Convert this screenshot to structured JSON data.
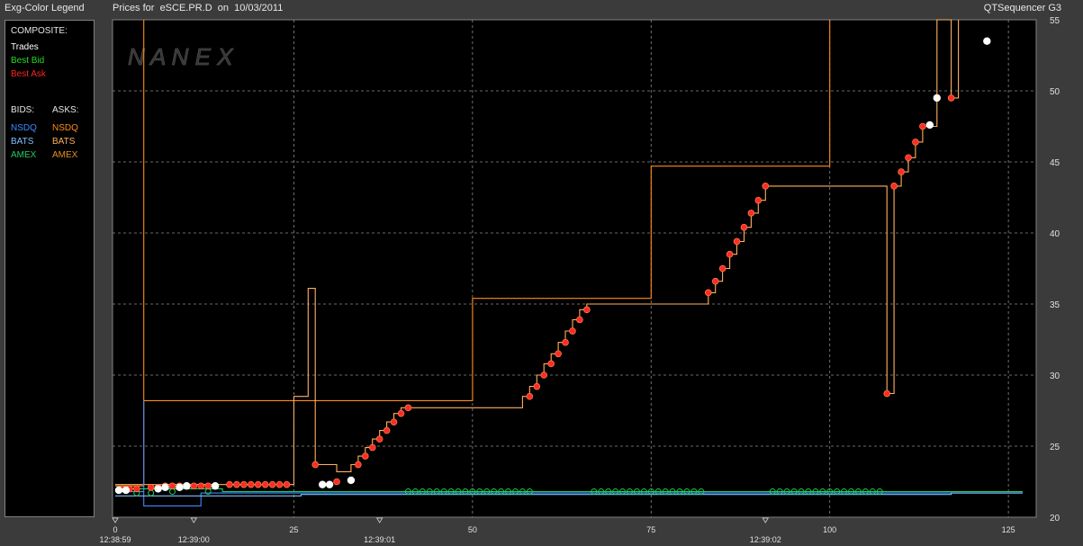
{
  "header": {
    "left_title": "Exg-Color Legend",
    "center_title": "Prices for  eSCE.PR.D  on  10/03/2011",
    "right_title": "QTSequencer G3"
  },
  "watermark": "N A N E X",
  "legend": {
    "composite_label": "COMPOSITE:",
    "composite": [
      {
        "label": "Trades",
        "color": "#ffffff"
      },
      {
        "label": "Best Bid",
        "color": "#22dd22"
      },
      {
        "label": "Best Ask",
        "color": "#ff2222"
      }
    ],
    "bids_label": "BIDS:",
    "asks_label": "ASKS:",
    "bids": [
      {
        "label": "NSDQ",
        "color": "#3a8cff"
      },
      {
        "label": "BATS",
        "color": "#7fc0ff"
      },
      {
        "label": "AMEX",
        "color": "#22cc66"
      }
    ],
    "asks": [
      {
        "label": "NSDQ",
        "color": "#ff8c1a"
      },
      {
        "label": "BATS",
        "color": "#ffb060"
      },
      {
        "label": "AMEX",
        "color": "#e09020"
      }
    ]
  },
  "chart_data": {
    "type": "line",
    "xlim": [
      0,
      127
    ],
    "ylim": [
      20,
      55
    ],
    "x_ticks": [
      0,
      25,
      50,
      75,
      100,
      125
    ],
    "y_ticks": [
      20,
      25,
      30,
      35,
      40,
      45,
      50,
      55
    ],
    "time_labels": [
      {
        "x": 0,
        "label": "12:38:59"
      },
      {
        "x": 11,
        "label": "12:39:00"
      },
      {
        "x": 37,
        "label": "12:39:01"
      },
      {
        "x": 91,
        "label": "12:39:02"
      }
    ],
    "grid": true,
    "series": [
      {
        "kind": "ask-nsdq",
        "color": "#ff8c1a",
        "points": [
          [
            0,
            22.2
          ],
          [
            4,
            22.2
          ],
          [
            4,
            55
          ],
          [
            4,
            28.2
          ],
          [
            25.5,
            28.2
          ],
          [
            25.5,
            28.2
          ],
          [
            50,
            28.2
          ],
          [
            50,
            35.4
          ],
          [
            75,
            35.4
          ],
          [
            75,
            44.7
          ],
          [
            100,
            44.7
          ],
          [
            100,
            55
          ]
        ]
      },
      {
        "kind": "ask-bats",
        "color": "#ffb060",
        "points": [
          [
            0,
            22.3
          ],
          [
            25,
            22.3
          ],
          [
            25,
            28.5
          ],
          [
            27,
            28.5
          ],
          [
            27,
            36.1
          ],
          [
            28,
            36.1
          ],
          [
            28,
            23.7
          ],
          [
            31,
            23.7
          ],
          [
            31,
            23.2
          ],
          [
            33,
            23.2
          ],
          [
            33,
            23.7
          ],
          [
            34,
            23.7
          ],
          [
            34,
            24.3
          ],
          [
            35,
            24.3
          ],
          [
            35,
            24.9
          ],
          [
            36,
            24.9
          ],
          [
            36,
            25.5
          ],
          [
            37,
            25.5
          ],
          [
            37,
            26.1
          ],
          [
            38,
            26.1
          ],
          [
            38,
            26.7
          ],
          [
            39,
            26.7
          ],
          [
            39,
            27.3
          ],
          [
            40,
            27.3
          ],
          [
            40,
            27.7
          ],
          [
            57,
            27.7
          ],
          [
            57,
            28.5
          ],
          [
            58,
            28.5
          ],
          [
            58,
            29.2
          ],
          [
            59,
            29.2
          ],
          [
            59,
            30
          ],
          [
            60,
            30
          ],
          [
            60,
            30.8
          ],
          [
            61,
            30.8
          ],
          [
            61,
            31.5
          ],
          [
            62,
            31.5
          ],
          [
            62,
            32.3
          ],
          [
            63,
            32.3
          ],
          [
            63,
            33.1
          ],
          [
            64,
            33.1
          ],
          [
            64,
            33.9
          ],
          [
            65,
            33.9
          ],
          [
            65,
            34.6
          ],
          [
            66,
            34.6
          ],
          [
            66,
            35
          ],
          [
            83,
            35
          ],
          [
            83,
            35.8
          ],
          [
            84,
            35.8
          ],
          [
            84,
            36.6
          ],
          [
            85,
            36.6
          ],
          [
            85,
            37.5
          ],
          [
            86,
            37.5
          ],
          [
            86,
            38.5
          ],
          [
            87,
            38.5
          ],
          [
            87,
            39.4
          ],
          [
            88,
            39.4
          ],
          [
            88,
            40.4
          ],
          [
            89,
            40.4
          ],
          [
            89,
            41.4
          ],
          [
            90,
            41.4
          ],
          [
            90,
            42.3
          ],
          [
            91,
            42.3
          ],
          [
            91,
            43.3
          ],
          [
            108,
            43.3
          ],
          [
            108,
            28.7
          ],
          [
            109,
            28.7
          ],
          [
            109,
            43.3
          ],
          [
            110,
            43.3
          ],
          [
            110,
            44.3
          ],
          [
            111,
            44.3
          ],
          [
            111,
            45.3
          ],
          [
            112,
            45.3
          ],
          [
            112,
            46.4
          ],
          [
            113,
            46.4
          ],
          [
            113,
            47.5
          ],
          [
            115,
            47.5
          ],
          [
            115,
            55
          ],
          [
            117,
            55
          ],
          [
            117,
            49.5
          ],
          [
            118,
            49.5
          ],
          [
            118,
            55
          ]
        ]
      },
      {
        "kind": "bid-nsdq",
        "color": "#3a8cff",
        "points": [
          [
            0,
            21.8
          ],
          [
            4,
            21.8
          ],
          [
            4,
            28.2
          ],
          [
            4,
            20.8
          ],
          [
            12,
            20.8
          ],
          [
            12,
            21.7
          ],
          [
            127,
            21.7
          ]
        ]
      },
      {
        "kind": "bid-bats",
        "color": "#7fc0ff",
        "points": [
          [
            0,
            21.5
          ],
          [
            26,
            21.5
          ],
          [
            26,
            21.6
          ],
          [
            117,
            21.6
          ],
          [
            117,
            21.7
          ],
          [
            127,
            21.7
          ]
        ]
      },
      {
        "kind": "bid-amex",
        "color": "#22cc66",
        "points": [
          [
            0,
            22.0
          ],
          [
            15,
            22.0
          ],
          [
            15,
            21.8
          ],
          [
            127,
            21.8
          ]
        ]
      }
    ],
    "best_ask_points": [
      [
        1,
        22.0
      ],
      [
        2,
        22.0
      ],
      [
        3,
        22.0
      ],
      [
        5,
        22.1
      ],
      [
        6,
        22.1
      ],
      [
        7,
        22.2
      ],
      [
        8,
        22.2
      ],
      [
        9,
        22.2
      ],
      [
        10,
        22.2
      ],
      [
        11,
        22.2
      ],
      [
        12,
        22.2
      ],
      [
        13,
        22.2
      ],
      [
        14,
        22.2
      ],
      [
        16,
        22.3
      ],
      [
        17,
        22.3
      ],
      [
        18,
        22.3
      ],
      [
        19,
        22.3
      ],
      [
        20,
        22.3
      ],
      [
        21,
        22.3
      ],
      [
        22,
        22.3
      ],
      [
        23,
        22.3
      ],
      [
        24,
        22.3
      ],
      [
        28,
        23.7
      ],
      [
        31,
        22.5
      ],
      [
        34,
        23.7
      ],
      [
        35,
        24.3
      ],
      [
        36,
        24.9
      ],
      [
        37,
        25.5
      ],
      [
        38,
        26.1
      ],
      [
        39,
        26.7
      ],
      [
        40,
        27.3
      ],
      [
        41,
        27.7
      ],
      [
        58,
        28.5
      ],
      [
        59,
        29.2
      ],
      [
        60,
        30
      ],
      [
        61,
        30.8
      ],
      [
        62,
        31.5
      ],
      [
        63,
        32.3
      ],
      [
        64,
        33.1
      ],
      [
        65,
        33.9
      ],
      [
        66,
        34.6
      ],
      [
        83,
        35.8
      ],
      [
        84,
        36.6
      ],
      [
        85,
        37.5
      ],
      [
        86,
        38.5
      ],
      [
        87,
        39.4
      ],
      [
        88,
        40.4
      ],
      [
        89,
        41.4
      ],
      [
        90,
        42.3
      ],
      [
        91,
        43.3
      ],
      [
        108,
        28.7
      ],
      [
        109,
        43.3
      ],
      [
        110,
        44.3
      ],
      [
        111,
        45.3
      ],
      [
        112,
        46.4
      ],
      [
        113,
        47.5
      ],
      [
        117,
        49.5
      ]
    ],
    "best_bid_points": [
      [
        3,
        21.7
      ],
      [
        5,
        21.7
      ],
      [
        8,
        21.8
      ],
      [
        13,
        21.8
      ],
      [
        41,
        21.8
      ],
      [
        42,
        21.8
      ],
      [
        43,
        21.8
      ],
      [
        44,
        21.8
      ],
      [
        45,
        21.8
      ],
      [
        46,
        21.8
      ],
      [
        47,
        21.8
      ],
      [
        48,
        21.8
      ],
      [
        49,
        21.8
      ],
      [
        50,
        21.8
      ],
      [
        51,
        21.8
      ],
      [
        52,
        21.8
      ],
      [
        53,
        21.8
      ],
      [
        54,
        21.8
      ],
      [
        55,
        21.8
      ],
      [
        56,
        21.8
      ],
      [
        57,
        21.8
      ],
      [
        58,
        21.8
      ],
      [
        67,
        21.8
      ],
      [
        68,
        21.8
      ],
      [
        69,
        21.8
      ],
      [
        70,
        21.8
      ],
      [
        71,
        21.8
      ],
      [
        72,
        21.8
      ],
      [
        73,
        21.8
      ],
      [
        74,
        21.8
      ],
      [
        75,
        21.8
      ],
      [
        76,
        21.8
      ],
      [
        77,
        21.8
      ],
      [
        78,
        21.8
      ],
      [
        79,
        21.8
      ],
      [
        80,
        21.8
      ],
      [
        81,
        21.8
      ],
      [
        82,
        21.8
      ],
      [
        92,
        21.8
      ],
      [
        93,
        21.8
      ],
      [
        94,
        21.8
      ],
      [
        95,
        21.8
      ],
      [
        96,
        21.8
      ],
      [
        97,
        21.8
      ],
      [
        98,
        21.8
      ],
      [
        99,
        21.8
      ],
      [
        100,
        21.8
      ],
      [
        101,
        21.8
      ],
      [
        102,
        21.8
      ],
      [
        103,
        21.8
      ],
      [
        104,
        21.8
      ],
      [
        105,
        21.8
      ],
      [
        106,
        21.8
      ],
      [
        107,
        21.8
      ]
    ],
    "trade_points": [
      [
        0.5,
        21.9
      ],
      [
        1.5,
        21.9
      ],
      [
        6,
        22.0
      ],
      [
        7,
        22.1
      ],
      [
        9,
        22.1
      ],
      [
        10,
        22.2
      ],
      [
        14,
        22.2
      ],
      [
        29,
        22.3
      ],
      [
        30,
        22.3
      ],
      [
        33,
        22.6
      ],
      [
        114,
        47.6
      ],
      [
        115,
        49.5
      ],
      [
        122,
        53.5
      ]
    ]
  }
}
